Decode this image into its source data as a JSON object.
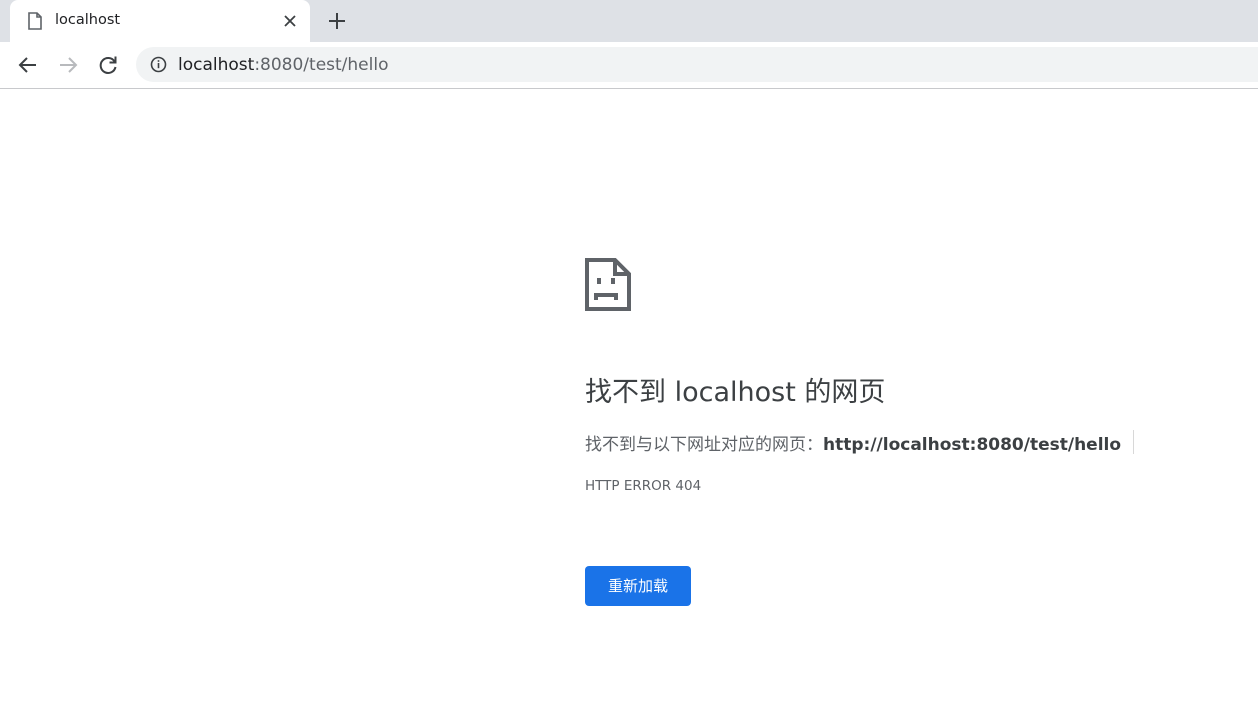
{
  "browser": {
    "tab": {
      "title": "localhost",
      "favicon": "page-icon"
    },
    "new_tab_icon": "plus-icon",
    "nav": {
      "back_icon": "back-arrow-icon",
      "forward_icon": "forward-arrow-icon",
      "reload_icon": "reload-icon"
    },
    "omnibox": {
      "security_icon": "info-icon",
      "url_host": "localhost",
      "url_rest": ":8080/test/hello"
    }
  },
  "error_page": {
    "icon": "sad-document-icon",
    "heading": "找不到 localhost 的网页",
    "description_prefix": "找不到与以下网址对应的网页：",
    "description_url": "http://localhost:8080/test/hello",
    "error_code": "HTTP ERROR 404",
    "reload_label": "重新加载",
    "accent_color": "#1a73e8"
  }
}
